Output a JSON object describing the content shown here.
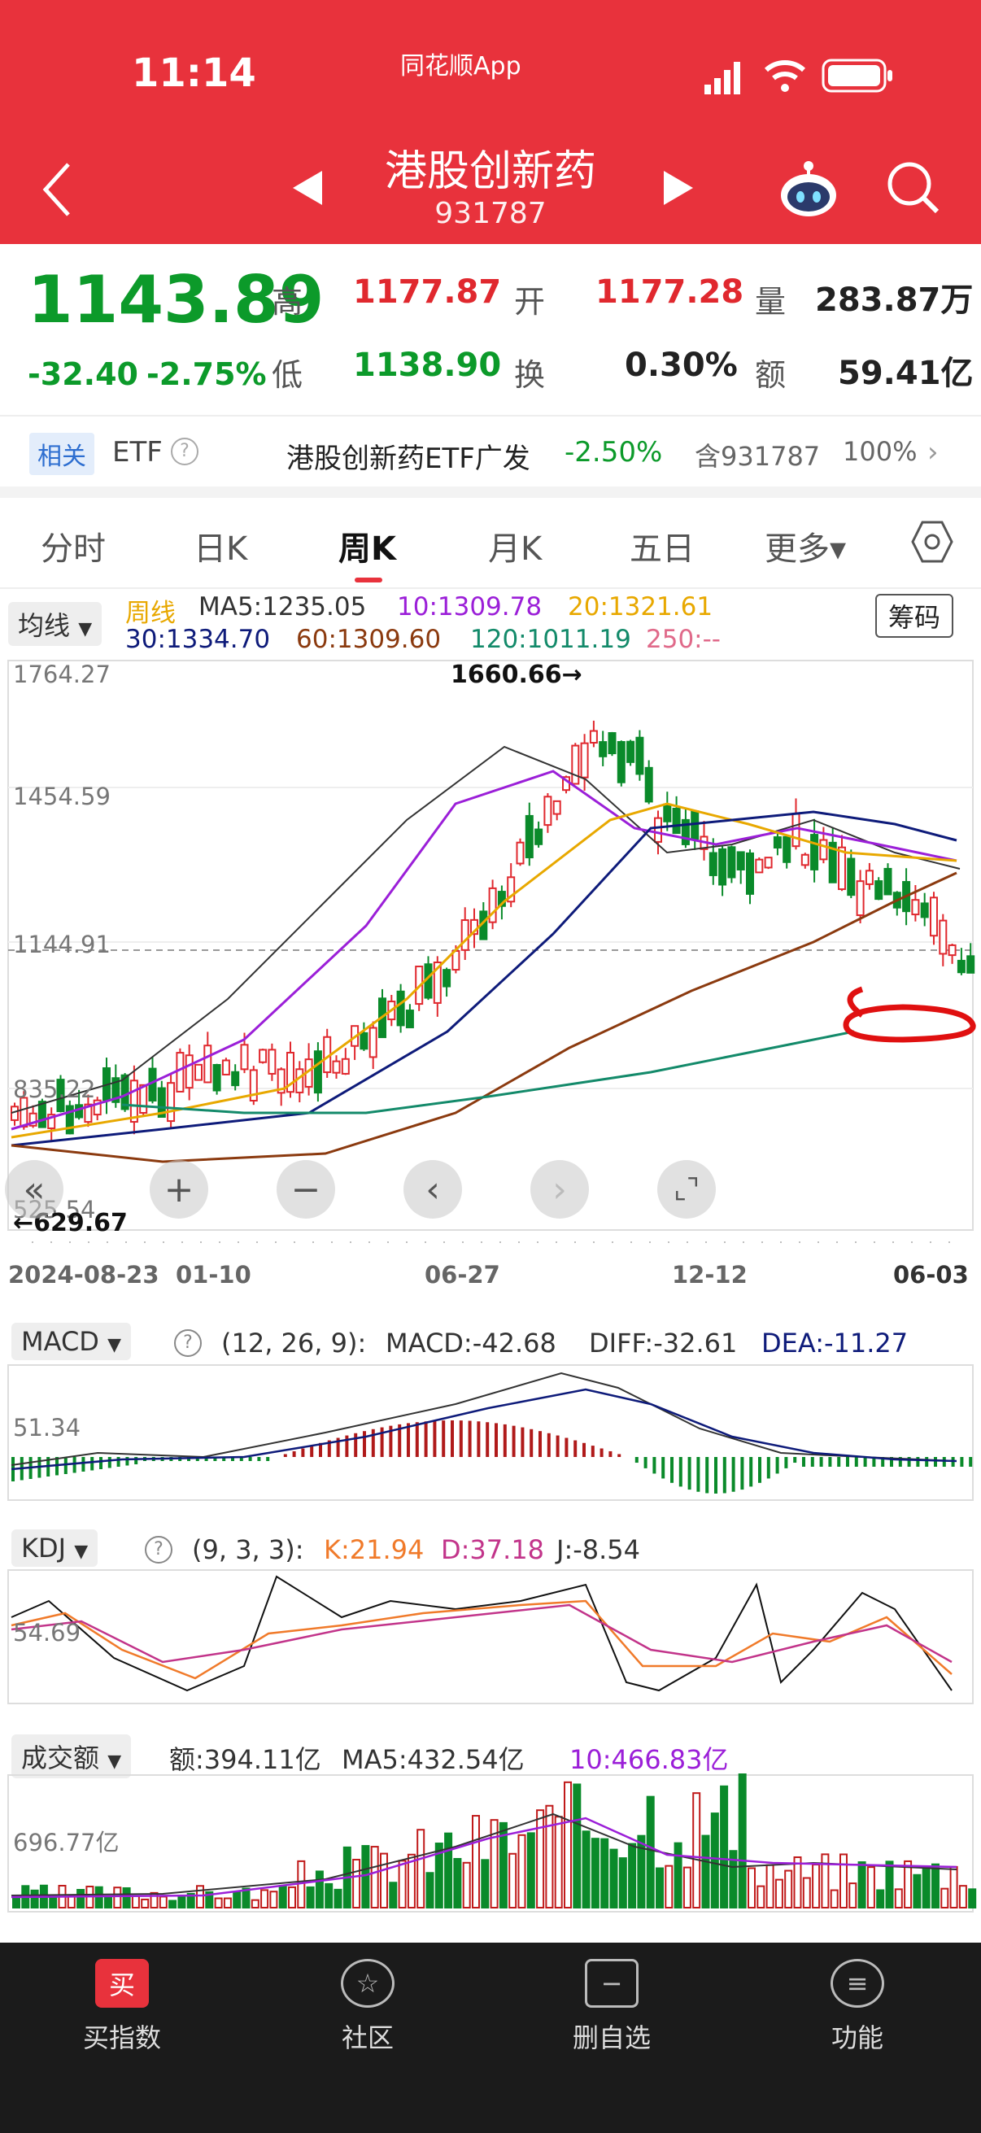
{
  "status": {
    "time": "11:14",
    "app": "同花顺App"
  },
  "header": {
    "title": "港股创新药",
    "code": "931787"
  },
  "quote": {
    "price": "1143.89",
    "change": "-32.40",
    "change_pct": "-2.75%",
    "high_label": "高",
    "high": "1177.87",
    "low_label": "低",
    "low": "1138.90",
    "open_label": "开",
    "open": "1177.28",
    "turnover_label": "换",
    "turnover": "0.30%",
    "volume_label": "量",
    "volume": "283.87万",
    "amount_label": "额",
    "amount": "59.41亿"
  },
  "etf": {
    "tag": "相关",
    "type": "ETF",
    "name": "港股创新药ETF广发",
    "change": "-2.50%",
    "contain": "含931787",
    "weight": "100%"
  },
  "tabs": [
    "分时",
    "日K",
    "周K",
    "月K",
    "五日",
    "更多▾"
  ],
  "ma": {
    "selector": "均线",
    "period": "周线",
    "chip_button": "筹码",
    "ma5": "MA5:1235.05",
    "ma10": "10:1309.78",
    "ma20": "20:1321.61",
    "ma30": "30:1334.70",
    "ma60": "60:1309.60",
    "ma120": "120:1011.19",
    "ma250": "250:--"
  },
  "kline": {
    "y_labels": [
      "1764.27",
      "1454.59",
      "1144.91",
      "835.22",
      "525.54"
    ],
    "max_label": "1660.66→",
    "min_label": "←629.67",
    "x_labels": [
      "2024-08-23",
      "01-10",
      "06-27",
      "12-12",
      "06-03"
    ],
    "colors": {
      "ma5": "#333333",
      "ma10": "#9b1fd8",
      "ma20": "#e8a800",
      "ma30": "#0e1b7a",
      "ma60": "#8b3a0f",
      "ma120": "#138a6a",
      "up": "#e0282e",
      "down": "#0a8a2a"
    }
  },
  "macd": {
    "name": "MACD",
    "params": "(12, 26, 9):",
    "macd": "MACD:-42.68",
    "diff": "DIFF:-32.61",
    "dea": "DEA:-11.27",
    "y_label": "51.34"
  },
  "kdj": {
    "name": "KDJ",
    "params": "(9, 3, 3):",
    "k": "K:21.94",
    "d": "D:37.18",
    "j": "J:-8.54",
    "y_label": "54.69"
  },
  "vol": {
    "name": "成交额",
    "amount": "额:394.11亿",
    "ma5": "MA5:432.54亿",
    "ma10": "10:466.83亿",
    "y_label": "696.77亿"
  },
  "nav": [
    {
      "label": "买指数",
      "icon": "买"
    },
    {
      "label": "社区",
      "icon": "☆"
    },
    {
      "label": "删自选",
      "icon": "−"
    },
    {
      "label": "功能",
      "icon": "≡"
    }
  ]
}
